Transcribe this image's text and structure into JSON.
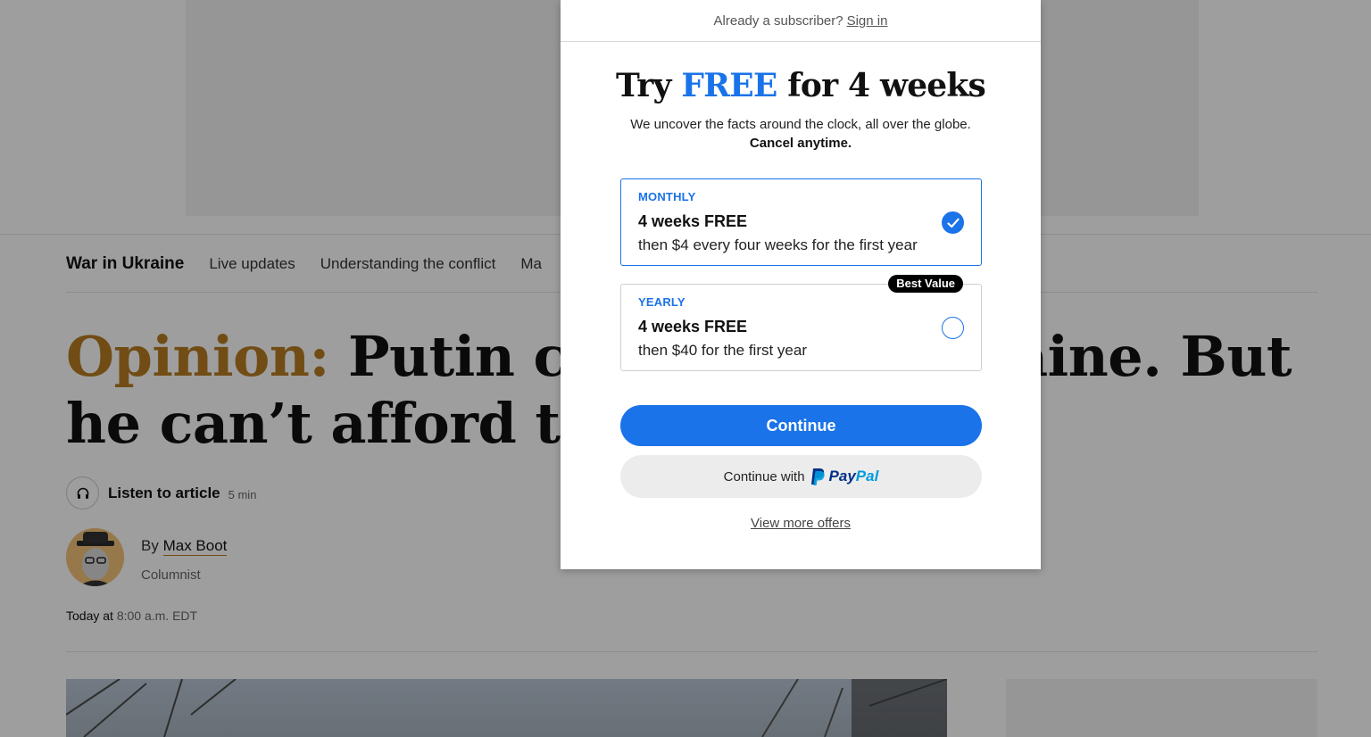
{
  "article": {
    "subnav": {
      "title": "War in Ukraine",
      "links": [
        "Live updates",
        "Understanding the conflict",
        "Ma"
      ]
    },
    "headline": {
      "kicker": "Opinion:",
      "text_line1": "Putin can’t",
      "text_line1_right": "aine. But",
      "text_line2": "he can’t afford to los"
    },
    "listen": {
      "label": "Listen to article",
      "duration": "5 min"
    },
    "byline": {
      "prefix": "By",
      "author": "Max Boot",
      "role": "Columnist"
    },
    "dateline": {
      "prefix": "Today at",
      "time": "8:00 a.m. EDT"
    }
  },
  "modal": {
    "top": {
      "text": "Already a subscriber?",
      "signin": "Sign in"
    },
    "title": {
      "pre": "Try",
      "free": "FREE",
      "post": "for 4 weeks"
    },
    "subtitle": "We uncover the facts around the clock, all over the globe.",
    "cancel": "Cancel anytime.",
    "offers": [
      {
        "plan": "MONTHLY",
        "trial": "4 weeks FREE",
        "price": "then $4 every four weeks for the first year",
        "selected": true
      },
      {
        "plan": "YEARLY",
        "trial": "4 weeks FREE",
        "price": "then $40 for the first year",
        "badge": "Best Value",
        "selected": false
      }
    ],
    "continue_label": "Continue",
    "paypal": {
      "label": "Continue with",
      "word_pay": "Pay",
      "word_pal": "Pal"
    },
    "more_offers": "View more offers"
  },
  "colors": {
    "accent": "#1a73e8",
    "opinion_kicker": "#b77d22",
    "overlay": "rgba(0,0,0,0.38)"
  }
}
